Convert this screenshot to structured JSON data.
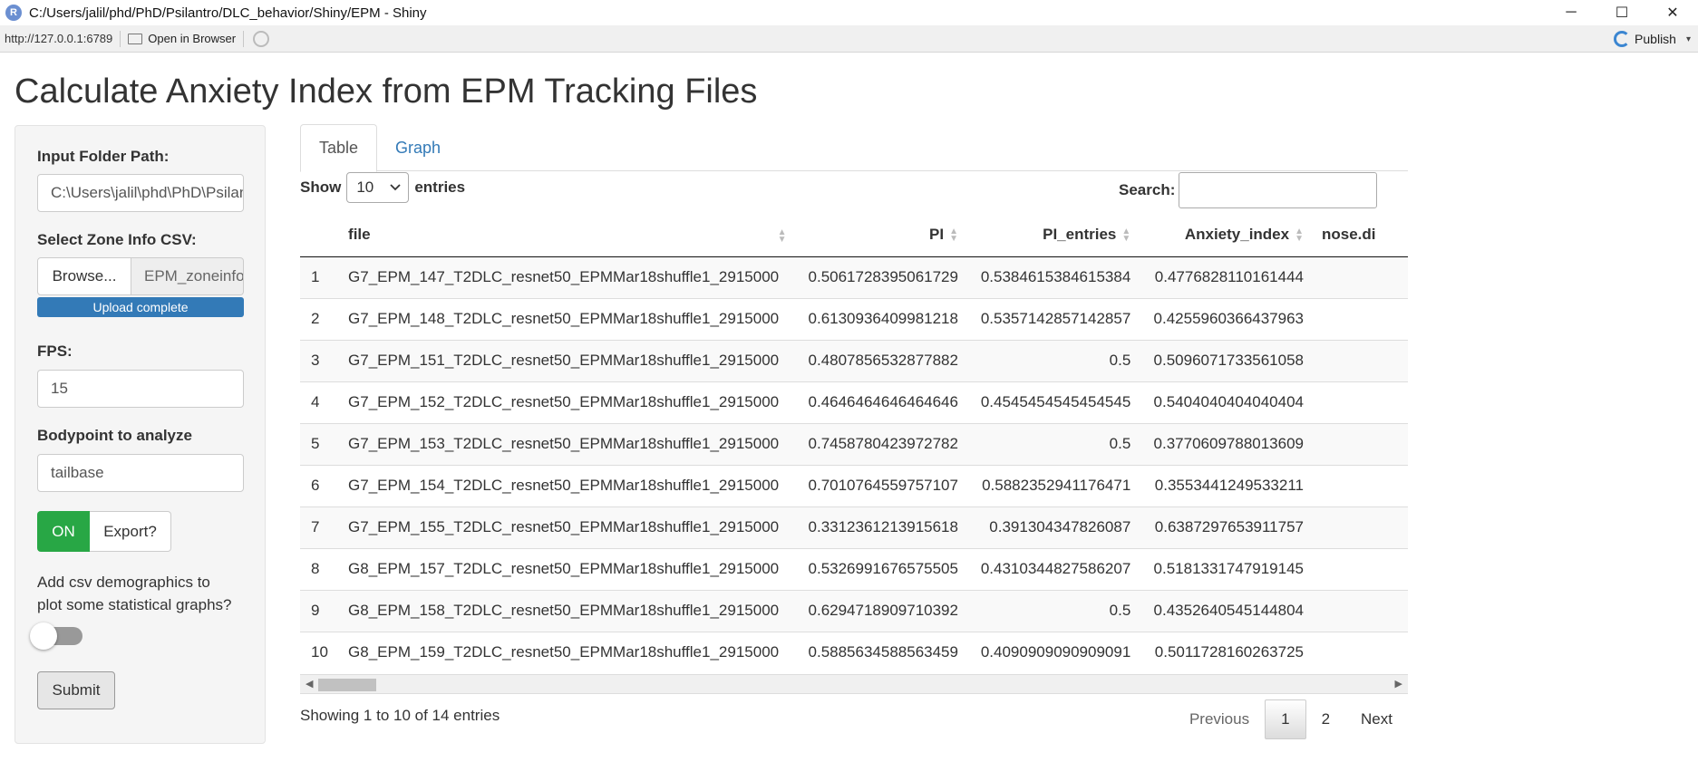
{
  "window": {
    "app_icon": "R",
    "title": "C:/Users/jalil/phd/PhD/Psilantro/DLC_behavior/Shiny/EPM - Shiny",
    "controls": {
      "minimize": "─",
      "maximize": "☐",
      "close": "✕"
    }
  },
  "toolbar": {
    "url": "http://127.0.0.1:6789",
    "open_in_browser": "Open in Browser",
    "publish": "Publish",
    "publish_arrow": "▾"
  },
  "page": {
    "title": "Calculate Anxiety Index from EPM Tracking Files"
  },
  "sidebar": {
    "folder_label": "Input Folder Path:",
    "folder_value": "C:\\Users\\jalil\\phd\\PhD\\Psilantro\\DLC_behavior",
    "zone_label": "Select Zone Info CSV:",
    "browse_label": "Browse...",
    "zone_file": "EPM_zoneinfo.csv",
    "upload_status": "Upload complete",
    "upload_progress": 1.0,
    "fps_label": "FPS:",
    "fps_value": "15",
    "bodypoint_label": "Bodypoint to analyze",
    "bodypoint_value": "tailbase",
    "export_on": "ON",
    "export_label": "Export?",
    "demographics_text": "Add csv demographics to plot some statistical graphs?",
    "demographics_enabled": false,
    "submit_label": "Submit"
  },
  "tabs": [
    {
      "label": "Table",
      "active": true
    },
    {
      "label": "Graph",
      "active": false
    }
  ],
  "table_controls": {
    "show": "Show",
    "page_length": "10",
    "entries": "entries",
    "search_label": "Search:",
    "search_value": ""
  },
  "table": {
    "columns": [
      "",
      "file",
      "PI",
      "PI_entries",
      "Anxiety_index",
      "nose.di"
    ],
    "rows": [
      [
        "1",
        "G7_EPM_147_T2DLC_resnet50_EPMMar18shuffle1_2915000",
        "0.5061728395061729",
        "0.5384615384615384",
        "0.4776828110161444"
      ],
      [
        "2",
        "G7_EPM_148_T2DLC_resnet50_EPMMar18shuffle1_2915000",
        "0.6130936409981218",
        "0.5357142857142857",
        "0.4255960366437963"
      ],
      [
        "3",
        "G7_EPM_151_T2DLC_resnet50_EPMMar18shuffle1_2915000",
        "0.4807856532877882",
        "0.5",
        "0.5096071733561058"
      ],
      [
        "4",
        "G7_EPM_152_T2DLC_resnet50_EPMMar18shuffle1_2915000",
        "0.4646464646464646",
        "0.4545454545454545",
        "0.5404040404040404"
      ],
      [
        "5",
        "G7_EPM_153_T2DLC_resnet50_EPMMar18shuffle1_2915000",
        "0.7458780423972782",
        "0.5",
        "0.3770609788013609"
      ],
      [
        "6",
        "G7_EPM_154_T2DLC_resnet50_EPMMar18shuffle1_2915000",
        "0.7010764559757107",
        "0.5882352941176471",
        "0.3553441249533211"
      ],
      [
        "7",
        "G7_EPM_155_T2DLC_resnet50_EPMMar18shuffle1_2915000",
        "0.3312361213915618",
        "0.391304347826087",
        "0.6387297653911757"
      ],
      [
        "8",
        "G8_EPM_157_T2DLC_resnet50_EPMMar18shuffle1_2915000",
        "0.5326991676575505",
        "0.4310344827586207",
        "0.5181331747919145"
      ],
      [
        "9",
        "G8_EPM_158_T2DLC_resnet50_EPMMar18shuffle1_2915000",
        "0.6294718909710392",
        "0.5",
        "0.4352640545144804"
      ],
      [
        "10",
        "G8_EPM_159_T2DLC_resnet50_EPMMar18shuffle1_2915000",
        "0.5885634588563459",
        "0.4090909090909091",
        "0.5011728160263725"
      ]
    ]
  },
  "footer": {
    "info": "Showing 1 to 10 of 14 entries",
    "previous": "Previous",
    "pages": [
      "1",
      "2"
    ],
    "current_page": "1",
    "next": "Next"
  },
  "colors": {
    "accent": "#337ab7",
    "on_green": "#28a745"
  }
}
